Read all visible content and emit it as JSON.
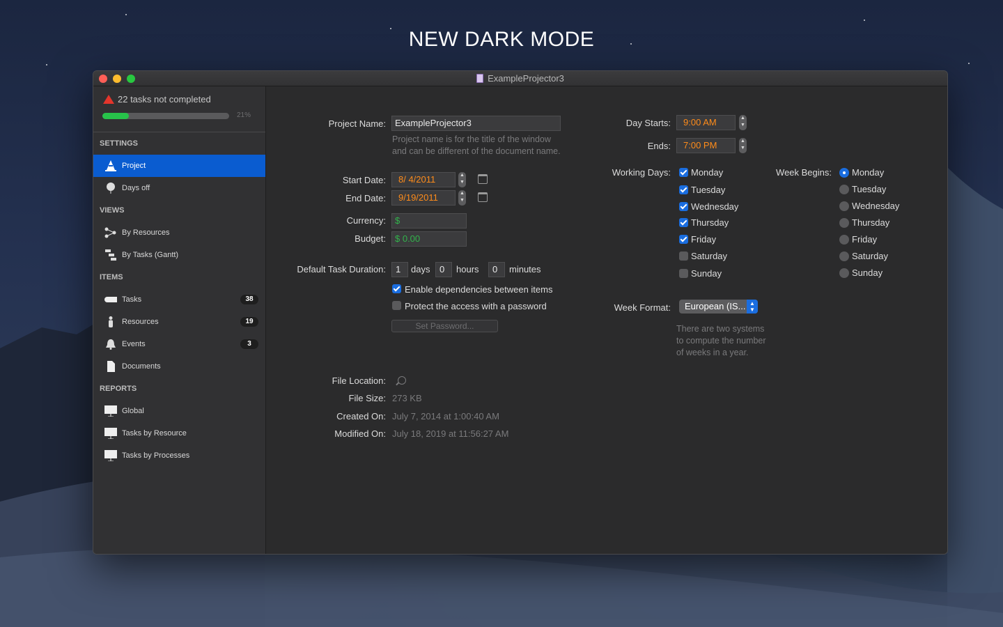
{
  "headline": "NEW DARK MODE",
  "window": {
    "title": "ExampleProjector3"
  },
  "sidebar": {
    "status": {
      "text": "22 tasks not completed",
      "percent": "21%",
      "progress": 0.21
    },
    "sections": {
      "settings": "SETTINGS",
      "views": "VIEWS",
      "items": "ITEMS",
      "reports": "REPORTS"
    },
    "settings_items": [
      {
        "label": "Project",
        "icon": "cone-icon"
      },
      {
        "label": "Days off",
        "icon": "balloon-icon"
      }
    ],
    "views_items": [
      {
        "label": "By Resources",
        "icon": "resources-tree-icon"
      },
      {
        "label": "By Tasks (Gantt)",
        "icon": "gantt-icon"
      }
    ],
    "items_items": [
      {
        "label": "Tasks",
        "icon": "task-bar-icon",
        "count": "38"
      },
      {
        "label": "Resources",
        "icon": "person-icon",
        "count": "19"
      },
      {
        "label": "Events",
        "icon": "bell-icon",
        "count": "3"
      },
      {
        "label": "Documents",
        "icon": "document-icon"
      }
    ],
    "reports_items": [
      {
        "label": "Global",
        "icon": "presentation-icon"
      },
      {
        "label": "Tasks by Resource",
        "icon": "presentation-icon"
      },
      {
        "label": "Tasks by Processes",
        "icon": "presentation-icon"
      }
    ]
  },
  "form": {
    "project_name_label": "Project Name:",
    "project_name": "ExampleProjector3",
    "project_name_hint_1": "Project name is for the title of the window",
    "project_name_hint_2": "and can be different of the document name.",
    "start_date_label": "Start Date:",
    "start_date": "8/  4/2011",
    "end_date_label": "End Date:",
    "end_date": "9/19/2011",
    "currency_label": "Currency:",
    "currency": "$",
    "budget_label": "Budget:",
    "budget": "$ 0.00",
    "duration_label": "Default Task Duration:",
    "duration_days": "1",
    "days_label": "days",
    "duration_hours": "0",
    "hours_label": "hours",
    "duration_minutes": "0",
    "minutes_label": "minutes",
    "enable_dependencies": "Enable dependencies between items",
    "protect_access": "Protect the access with a password",
    "set_password": "Set Password...",
    "file_location_label": "File Location:",
    "file_size_label": "File Size:",
    "file_size": "273 KB",
    "created_label": "Created On:",
    "created": "July 7, 2014 at 1:00:40 AM",
    "modified_label": "Modified On:",
    "modified": "July 18, 2019 at 11:56:27 AM"
  },
  "schedule": {
    "day_starts_label": "Day Starts:",
    "day_starts": "9:00 AM",
    "ends_label": "Ends:",
    "ends": "7:00 PM",
    "working_days_label": "Working Days:",
    "working_days": [
      {
        "day": "Monday",
        "checked": true
      },
      {
        "day": "Tuesday",
        "checked": true
      },
      {
        "day": "Wednesday",
        "checked": true
      },
      {
        "day": "Thursday",
        "checked": true
      },
      {
        "day": "Friday",
        "checked": true
      },
      {
        "day": "Saturday",
        "checked": false
      },
      {
        "day": "Sunday",
        "checked": false
      }
    ],
    "week_begins_label": "Week Begins:",
    "week_begins": [
      "Monday",
      "Tuesday",
      "Wednesday",
      "Thursday",
      "Friday",
      "Saturday",
      "Sunday"
    ],
    "week_begins_selected": "Monday",
    "week_format_label": "Week Format:",
    "week_format": "European (IS...",
    "week_format_hint_1": "There are two systems",
    "week_format_hint_2": "to compute the number",
    "week_format_hint_3": "of weeks in a year."
  },
  "colors": {
    "accent": "#0a5cd0",
    "progress": "#27c24a",
    "warning": "#e3352b",
    "time_value": "#ff8c1a",
    "currency_value": "#31b44b"
  }
}
